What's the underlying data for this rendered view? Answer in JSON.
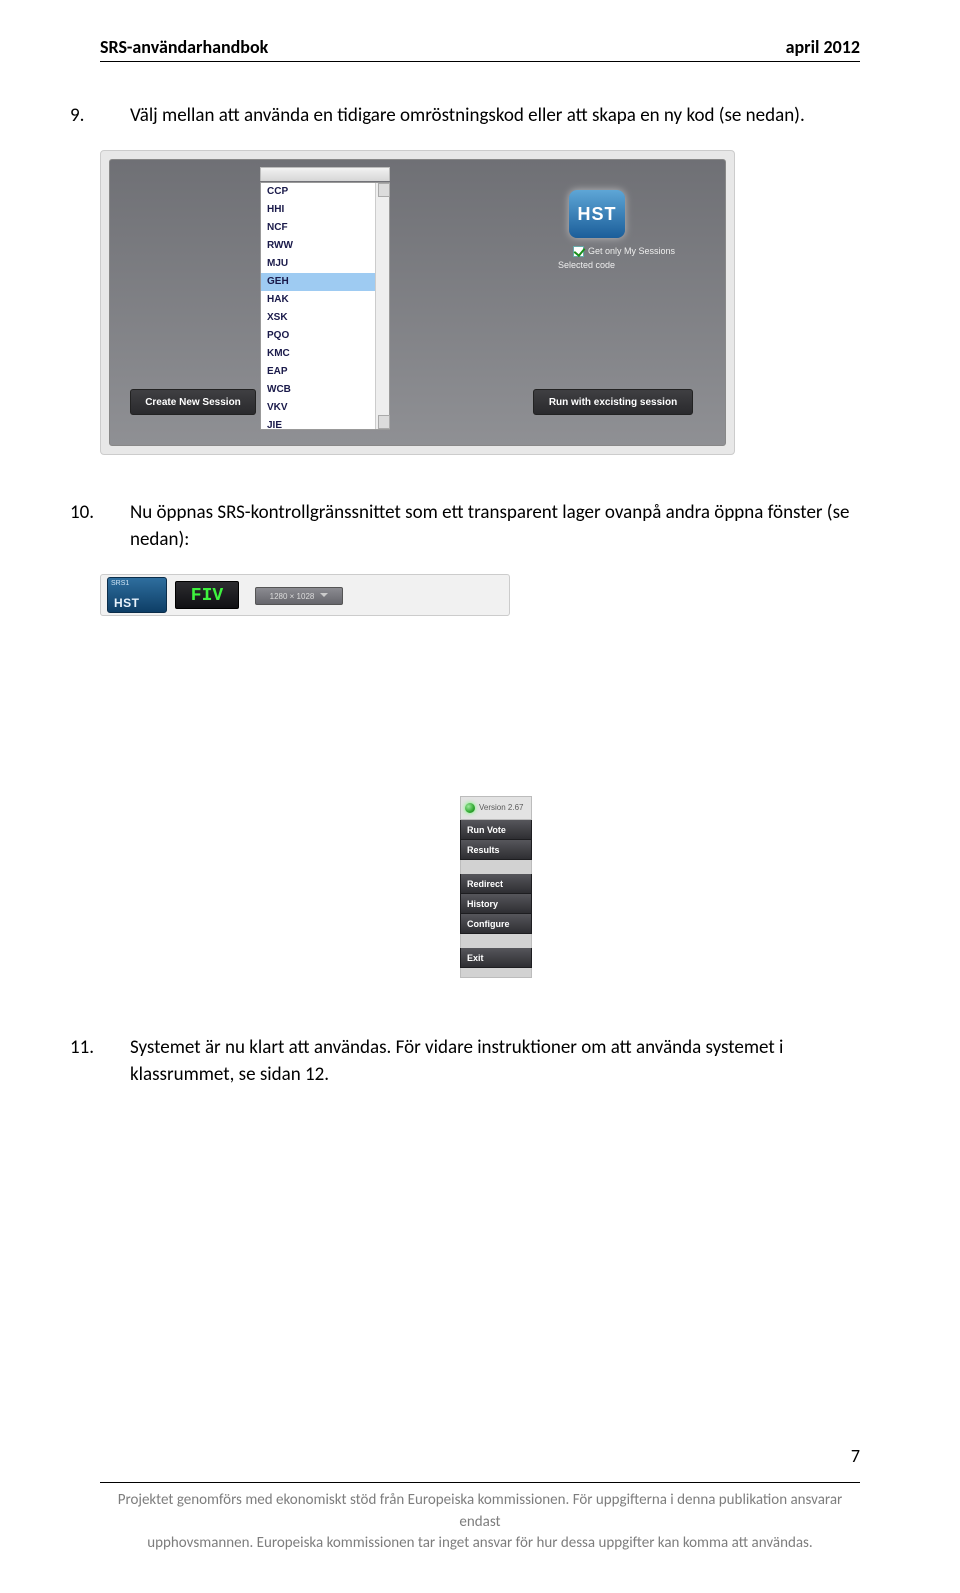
{
  "header": {
    "left": "SRS-användarhandbok",
    "right": "april 2012"
  },
  "step9": {
    "num": "9.",
    "text": "Välj mellan att använda en tidigare omröstningskod eller att skapa en ny kod (se nedan)."
  },
  "shot1": {
    "codes": [
      "CCP",
      "HHI",
      "NCF",
      "RWW",
      "MJU",
      "GEH",
      "HAK",
      "XSK",
      "PQO",
      "KMC",
      "EAP",
      "WCB",
      "VKV",
      "JIE"
    ],
    "selected_index": 5,
    "create_btn": "Create New Session",
    "run_btn": "Run with excisting session",
    "badge": "HST",
    "checkbox_label": "Get only My Sessions",
    "selected_code_label": "Selected code"
  },
  "step10": {
    "num": "10.",
    "text": "Nu öppnas SRS-kontrollgränssnittet som ett transparent lager ovanpå andra öppna fönster (se nedan):"
  },
  "shot2": {
    "tab_small": "SRS1",
    "tab_main": "HST",
    "code": "FIV",
    "resolution": "1280 × 1028"
  },
  "shot3": {
    "version": "Version 2.67",
    "buttons": [
      "Run Vote",
      "Results",
      "Redirect",
      "History",
      "Configure",
      "Exit"
    ]
  },
  "step11": {
    "num": "11.",
    "text": "Systemet är nu klart att användas. För vidare instruktioner om att använda systemet i klassrummet, se sidan 12."
  },
  "footer": {
    "page": "7",
    "line1": "Projektet genomförs med ekonomiskt stöd från Europeiska kommissionen. För uppgifterna i denna publikation ansvarar endast",
    "line2": "upphovsmannen. Europeiska kommissionen tar inget ansvar för hur dessa uppgifter kan komma att användas."
  }
}
